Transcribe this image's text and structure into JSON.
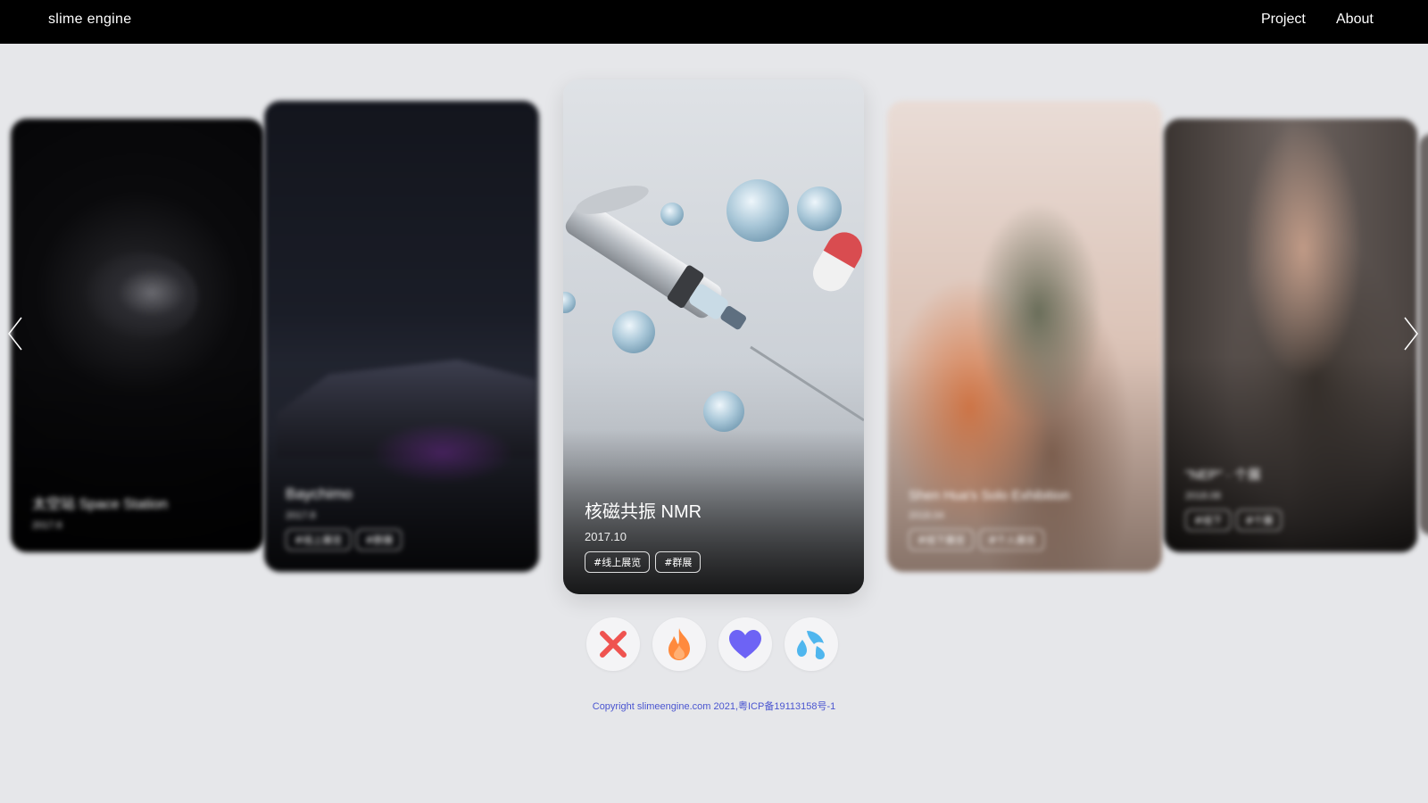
{
  "header": {
    "logo": "slime engine",
    "nav": [
      {
        "label": "Project"
      },
      {
        "label": "About"
      }
    ]
  },
  "carousel": {
    "cards": [
      {
        "title": "太空站 Space Station",
        "date": "2017.6",
        "tags": []
      },
      {
        "title": "Baychimo",
        "date": "2017.8",
        "tags": [
          "#线上展览",
          "#群展"
        ]
      },
      {
        "title": "核磁共振 NMR",
        "date": "2017.10",
        "tags": [
          "#线上展览",
          "#群展"
        ]
      },
      {
        "title": "Shen Hua's Solo Exhibition",
        "date": "2018.04",
        "tags": [
          "#线下展览",
          "#个人展览"
        ]
      },
      {
        "title": "\"NEP\" · 个展",
        "date": "2018.08",
        "tags": [
          "#线下",
          "#个展"
        ]
      }
    ],
    "prev_icon": "chevron-left-icon",
    "next_icon": "chevron-right-icon"
  },
  "reactions": [
    {
      "icon": "cross-icon",
      "color": "#ef5350"
    },
    {
      "icon": "fire-icon",
      "color": "#ff8a3d"
    },
    {
      "icon": "heart-icon",
      "color": "#6d63f5"
    },
    {
      "icon": "sweat-drops-icon",
      "color": "#4fb6ee"
    }
  ],
  "footer": {
    "copyright": "Copyright slimeengine.com 2021,粤ICP备19113158号-1"
  }
}
